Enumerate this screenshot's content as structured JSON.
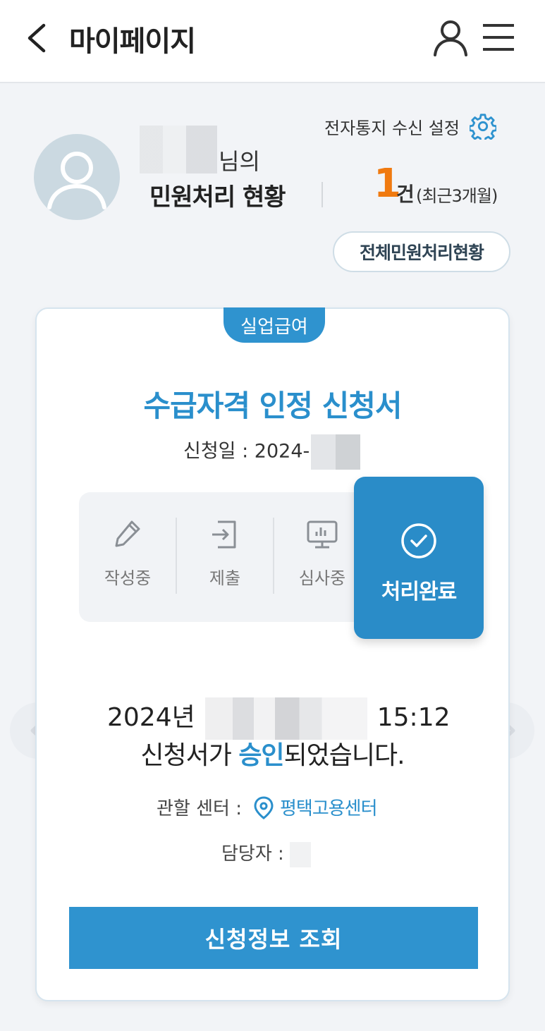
{
  "header": {
    "title": "마이페이지",
    "back_icon": "chevron-left-icon",
    "user_icon": "user-icon",
    "menu_icon": "hamburger-menu-icon"
  },
  "profile": {
    "notice_setting_label": "전자통지 수신 설정",
    "name_suffix": "님의",
    "status_title": "민원처리 현황",
    "count": "1",
    "count_unit": "건",
    "count_note": "(최근3개월)",
    "all_status_button": "전체민원처리현황"
  },
  "card": {
    "category": "실업급여",
    "title": "수급자격 인정 신청서",
    "apply_date_label": "신청일 : 2024-",
    "steps": [
      {
        "label": "작성중",
        "icon": "pencil-icon"
      },
      {
        "label": "제출",
        "icon": "submit-arrow-icon"
      },
      {
        "label": "심사중",
        "icon": "monitor-chart-icon"
      },
      {
        "label": "처리완료",
        "icon": "check-circle-icon",
        "active": true
      }
    ],
    "result_year": "2024년",
    "result_time": "15:12",
    "result_msg_prefix": "신청서가 ",
    "result_msg_highlight": "승인",
    "result_msg_suffix": "되었습니다.",
    "center_label": "관할 센터 :",
    "center_name": "평택고용센터",
    "manager_label": "담당자 :",
    "inquiry_button": "신청정보 조회"
  },
  "colors": {
    "accent": "#2f93cf",
    "count": "#f07a10",
    "background": "#f2f4f7"
  }
}
